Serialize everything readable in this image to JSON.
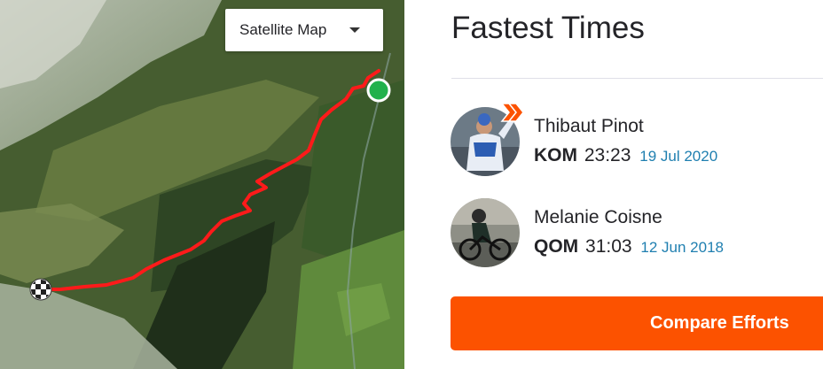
{
  "map": {
    "type_label": "Satellite Map",
    "start_marker_color": "#22b14c",
    "route_color": "#ff1a1a",
    "finish_marker": "checkered-flag-icon"
  },
  "panel": {
    "title": "Fastest Times",
    "leaders": [
      {
        "name": "Thibaut Pinot",
        "label": "KOM",
        "time": "23:23",
        "date": "19 Jul 2020",
        "badge": "double-chevron-icon"
      },
      {
        "name": "Melanie Coisne",
        "label": "QOM",
        "time": "31:03",
        "date": "12 Jun 2018"
      }
    ],
    "compare_label": "Compare Efforts"
  },
  "colors": {
    "accent": "#fc5200",
    "date_link": "#1f7fb0",
    "text": "#242428"
  }
}
